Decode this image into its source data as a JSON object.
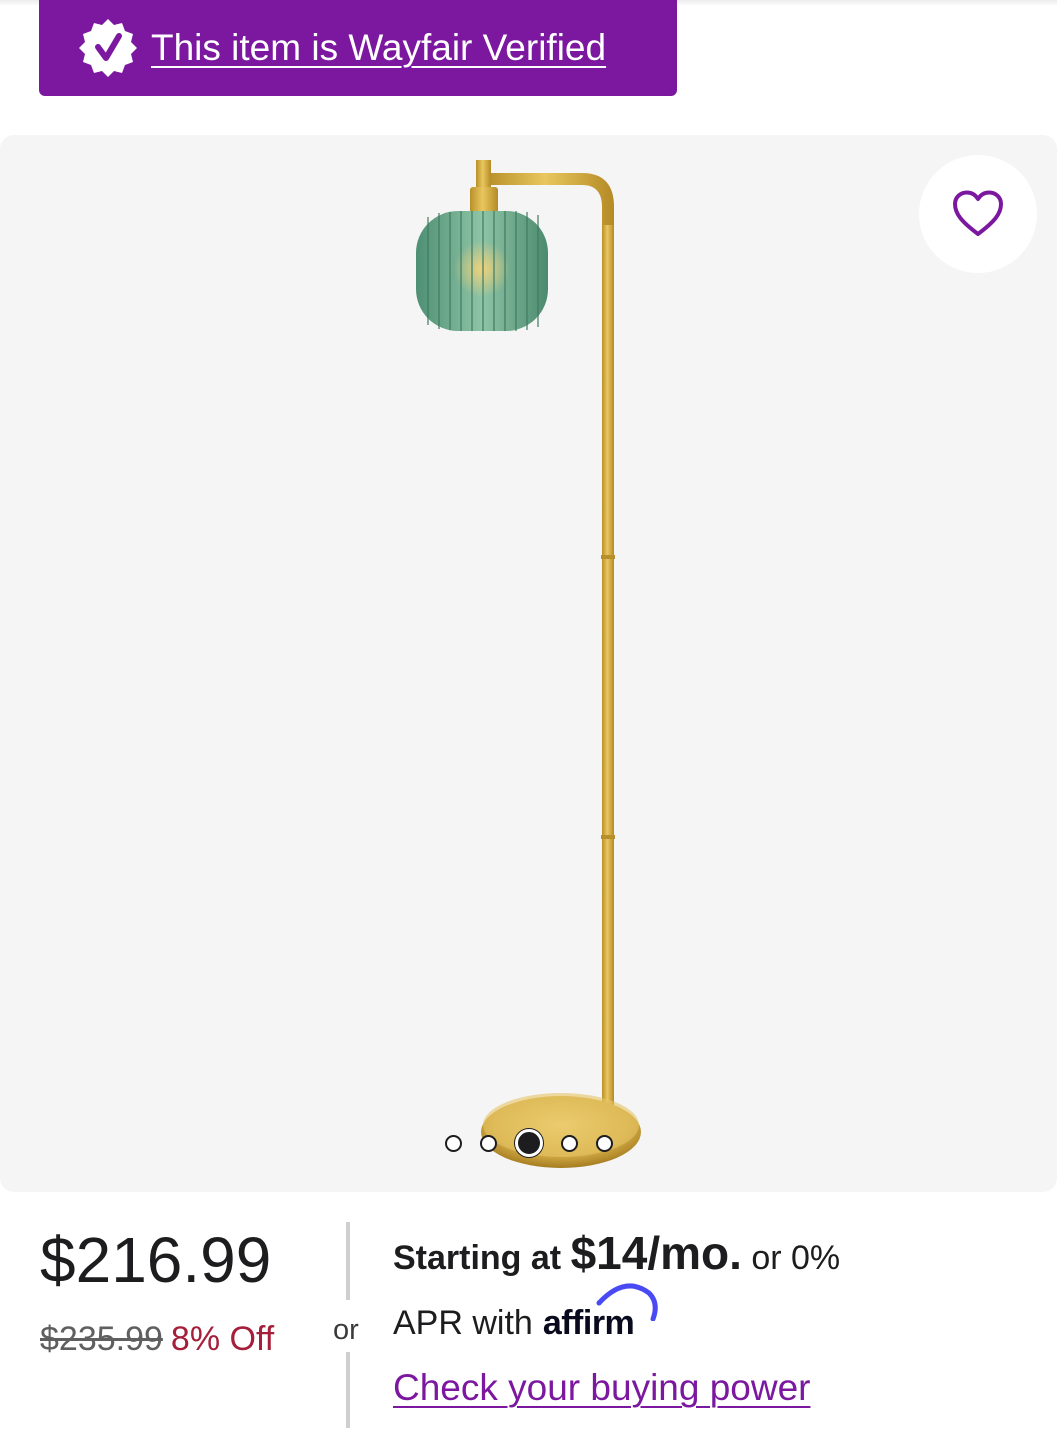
{
  "verified_banner": {
    "text": "This item is Wayfair Verified",
    "badge_icon": "verified-check-badge-icon",
    "background_color": "#7b189f"
  },
  "gallery": {
    "image_alt": "Brass floor lamp with green ribbed glass shade",
    "favorite_icon": "heart-outline-icon",
    "image_count": 5,
    "active_index": 2
  },
  "pricing": {
    "current_price": "$216.99",
    "original_price": "$235.99",
    "discount": "8% Off",
    "discount_color": "#a51e3a"
  },
  "separator": {
    "or_label": "or"
  },
  "financing": {
    "starting_at": "Starting at",
    "monthly": "$14/mo.",
    "or_zero": " or 0%",
    "apr_with": "APR with",
    "affirm_logo_text": "affirm",
    "buying_power_link": "Check your buying power",
    "link_color": "#7b189f"
  }
}
